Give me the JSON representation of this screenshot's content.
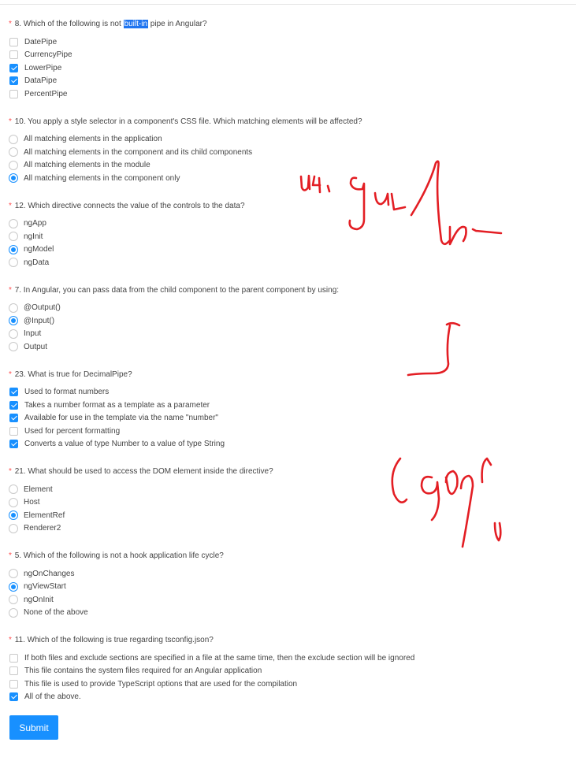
{
  "questions": [
    {
      "asterisk": "*",
      "title_pre": "8. Which of the following is not ",
      "title_highlight": "built-in",
      "title_post": " pipe in Angular?",
      "type": "checkbox",
      "options": [
        {
          "label": "DatePipe",
          "checked": false
        },
        {
          "label": "CurrencyPipe",
          "checked": false
        },
        {
          "label": "LowerPipe",
          "checked": true
        },
        {
          "label": "DataPipe",
          "checked": true
        },
        {
          "label": "PercentPipe",
          "checked": false
        }
      ]
    },
    {
      "asterisk": "*",
      "title": "10. You apply a style selector in a component's CSS file. Which matching elements will be affected?",
      "type": "radio",
      "options": [
        {
          "label": "All matching elements in the application",
          "checked": false
        },
        {
          "label": "All matching elements in the component and its child components",
          "checked": false
        },
        {
          "label": "All matching elements in the module",
          "checked": false
        },
        {
          "label": "All matching elements in the component only",
          "checked": true
        }
      ]
    },
    {
      "asterisk": "*",
      "title": "12. Which directive connects the value of the controls to the data?",
      "type": "radio",
      "options": [
        {
          "label": "ngApp",
          "checked": false
        },
        {
          "label": "ngInit",
          "checked": false
        },
        {
          "label": "ngModel",
          "checked": true
        },
        {
          "label": "ngData",
          "checked": false
        }
      ]
    },
    {
      "asterisk": "*",
      "title": "7. In Angular, you can pass data from the child component to the parent component by using:",
      "type": "radio",
      "options": [
        {
          "label": "@Output()",
          "checked": false
        },
        {
          "label": "@Input()",
          "checked": true
        },
        {
          "label": "Input",
          "checked": false
        },
        {
          "label": "Output",
          "checked": false
        }
      ]
    },
    {
      "asterisk": "*",
      "title": "23. What is true for DecimalPipe?",
      "type": "checkbox",
      "options": [
        {
          "label": "Used to format numbers",
          "checked": true
        },
        {
          "label": "Takes a number format as a template as a parameter",
          "checked": true
        },
        {
          "label": "Available for use in the template via the name \"number\"",
          "checked": true
        },
        {
          "label": "Used for percent formatting",
          "checked": false
        },
        {
          "label": "Converts a value of type Number to a value of type String",
          "checked": true
        }
      ]
    },
    {
      "asterisk": "*",
      "title": "21. What should be used to access the DOM element inside the directive?",
      "type": "radio",
      "options": [
        {
          "label": "Element",
          "checked": false
        },
        {
          "label": "Host",
          "checked": false
        },
        {
          "label": "ElementRef",
          "checked": true
        },
        {
          "label": "Renderer2",
          "checked": false
        }
      ]
    },
    {
      "asterisk": "*",
      "title": "5. Which of the following is not a hook application life cycle?",
      "type": "radio",
      "options": [
        {
          "label": "ngOnChanges",
          "checked": false
        },
        {
          "label": "ngViewStart",
          "checked": true
        },
        {
          "label": "ngOnInit",
          "checked": false
        },
        {
          "label": "None of the above",
          "checked": false
        }
      ]
    },
    {
      "asterisk": "*",
      "title": "11. Which of the following is true regarding tsconfig.json?",
      "type": "checkbox",
      "options": [
        {
          "label": "If both files and exclude sections are specified in a file at the same time, then the exclude section will be ignored",
          "checked": false
        },
        {
          "label": "This file contains the system files required for an Angular application",
          "checked": false
        },
        {
          "label": "This file is used to provide TypeScript options that are used for the compilation",
          "checked": false
        },
        {
          "label": "All of the above.",
          "checked": true
        }
      ]
    }
  ],
  "submit_label": "Submit",
  "colors": {
    "accent": "#1890ff",
    "required": "#ff4d4f",
    "annotation": "#e31e24",
    "highlight": "#1e74f0"
  },
  "handwritten_annotations": [
    "ink-scribble-top",
    "ink-scribble-middle",
    "ink-scribble-percent"
  ]
}
